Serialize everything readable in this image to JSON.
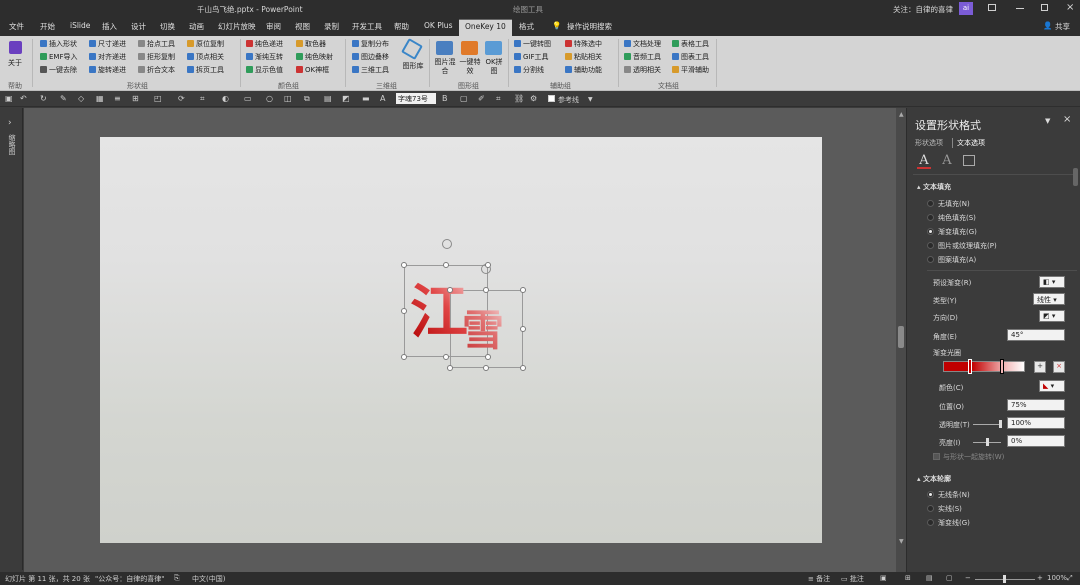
{
  "titlebar": {
    "doc_title": "千山鸟飞绝.pptx  -  PowerPoint",
    "context_tab": "绘图工具",
    "follow_text": "关注：自律的喜律",
    "avatar_text": "ai"
  },
  "tabs": [
    "文件",
    "开始",
    "iSlide",
    "插入",
    "设计",
    "切换",
    "动画",
    "幻灯片放映",
    "审阅",
    "视图",
    "录制",
    "开发工具",
    "帮助",
    "OK Plus",
    "OneKey 10",
    "格式",
    "操作说明搜索"
  ],
  "share_label": "共享",
  "ribbon": {
    "about": {
      "label": "关于",
      "group": "帮助"
    },
    "col1": [
      "插入形状",
      "EMF导入",
      "一键去除"
    ],
    "col2": [
      "尺寸递进",
      "对齐递进",
      "旋转递进"
    ],
    "col3": [
      "拾点工具",
      "拒形复制",
      "折合文本"
    ],
    "col4": [
      "原位复制",
      "顶点相关",
      "拆页工具"
    ],
    "group_shape": "形状组",
    "col5": [
      "纯色递进",
      "渐纯互转",
      "显示色值"
    ],
    "col6": [
      "取色器",
      "纯色映射",
      "OK神框"
    ],
    "group_color": "颜色组",
    "col7": [
      "复制分布",
      "图边叠移",
      "三维工具"
    ],
    "three_d_big": "图形库",
    "group_3d": "三维组",
    "big_buttons": [
      "图片混合",
      "一键特效",
      "OK拼图"
    ],
    "group_image": "图形组",
    "col8": [
      "一键转图",
      "GIF工具",
      "分割线"
    ],
    "col9": [
      "特殊选中",
      "粘贴相关",
      "辅助功能"
    ],
    "group_aux": "辅助组",
    "col10": [
      "文档处理",
      "音频工具",
      "透明相关"
    ],
    "col11": [
      "表格工具",
      "图表工具",
      "平滑辅助"
    ],
    "group_doc": "文档组"
  },
  "qat": {
    "font_name": "字魂73号",
    "guide_label": "参考线"
  },
  "leftstrip": {
    "label": "缩略图"
  },
  "slide": {
    "char1": "江",
    "char2": "雪"
  },
  "pane": {
    "title": "设置形状格式",
    "tab_shape": "形状选项",
    "tab_text": "文本选项",
    "text_fill_header": "文本填充",
    "fill_options": [
      "无填充(N)",
      "纯色填充(S)",
      "渐变填充(G)",
      "图片或纹理填充(P)",
      "图案填充(A)"
    ],
    "fill_selected": 2,
    "preset_label": "预设渐变(R)",
    "type_label": "类型(Y)",
    "type_value": "线性",
    "direction_label": "方向(D)",
    "angle_label": "角度(E)",
    "angle_value": "45°",
    "stops_label": "渐变光圈",
    "color_label": "颜色(C)",
    "position_label": "位置(O)",
    "position_value": "75%",
    "transparency_label": "透明度(T)",
    "transparency_value": "100%",
    "brightness_label": "亮度(I)",
    "brightness_value": "0%",
    "rotate_label": "与形状一起旋转(W)",
    "outline_header": "文本轮廓",
    "outline_options": [
      "无线条(N)",
      "实线(S)",
      "渐变线(G)"
    ],
    "outline_selected": 0,
    "gradient_color": "#c00000"
  },
  "status": {
    "slide_info": "幻灯片 第 11 张，共 20 张",
    "account": "\"公众号：自律的喜律\"",
    "language": "中文(中国)",
    "notes": "备注",
    "comments": "批注",
    "zoom": "100%"
  }
}
